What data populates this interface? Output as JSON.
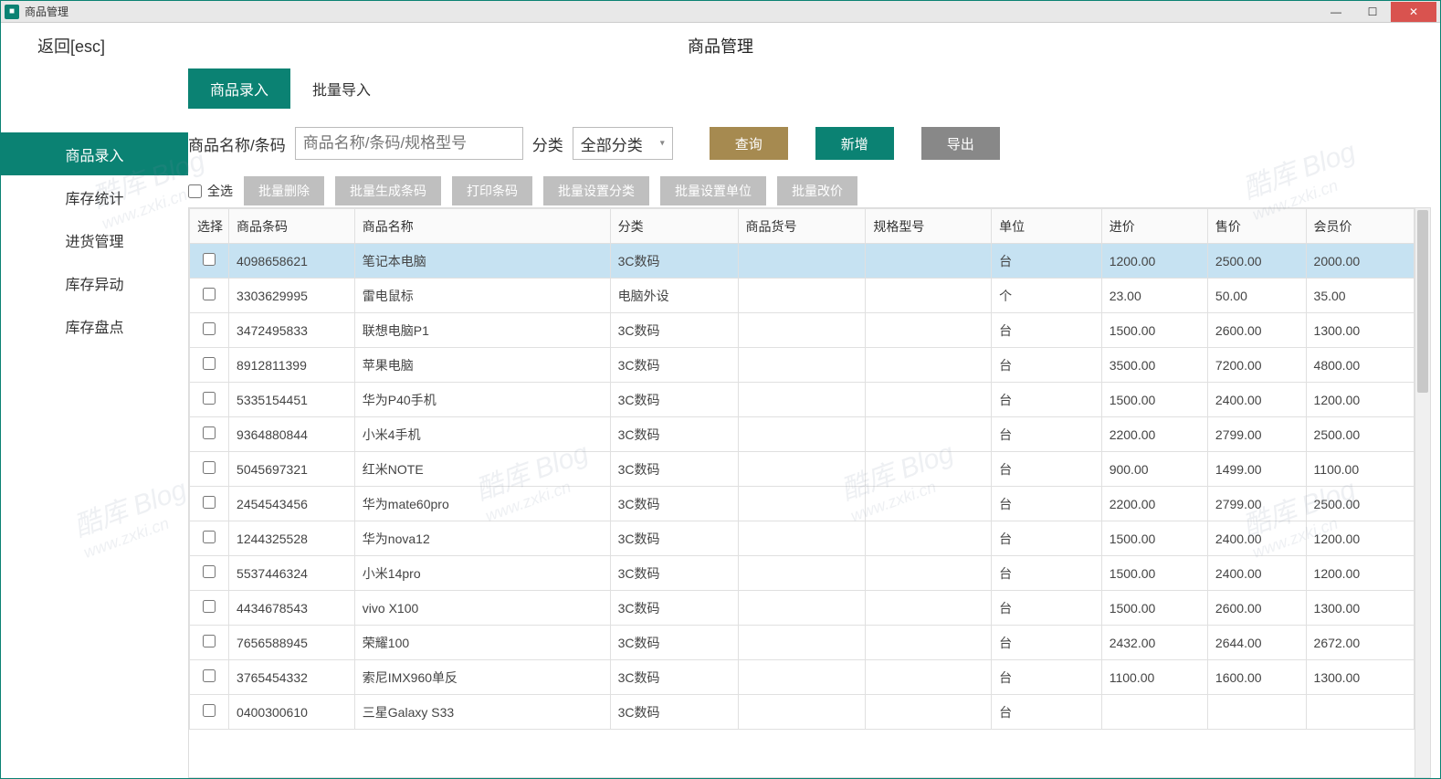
{
  "window": {
    "title": "商品管理"
  },
  "topbar": {
    "back": "返回[esc]",
    "title": "商品管理"
  },
  "sidebar": {
    "items": [
      {
        "label": "商品录入",
        "active": true
      },
      {
        "label": "库存统计",
        "active": false
      },
      {
        "label": "进货管理",
        "active": false
      },
      {
        "label": "库存异动",
        "active": false
      },
      {
        "label": "库存盘点",
        "active": false
      }
    ]
  },
  "tabs": [
    {
      "label": "商品录入",
      "active": true
    },
    {
      "label": "批量导入",
      "active": false
    }
  ],
  "filter": {
    "name_label": "商品名称/条码",
    "name_placeholder": "商品名称/条码/规格型号",
    "category_label": "分类",
    "category_value": "全部分类",
    "query_btn": "查询",
    "new_btn": "新增",
    "export_btn": "导出"
  },
  "batch": {
    "select_all": "全选",
    "buttons": [
      "批量删除",
      "批量生成条码",
      "打印条码",
      "批量设置分类",
      "批量设置单位",
      "批量改价"
    ]
  },
  "table": {
    "columns": [
      "选择",
      "商品条码",
      "商品名称",
      "分类",
      "商品货号",
      "规格型号",
      "单位",
      "进价",
      "售价",
      "会员价"
    ],
    "rows": [
      {
        "barcode": "4098658621",
        "name": "笔记本电脑",
        "category": "3C数码",
        "sku": "",
        "spec": "",
        "unit": "台",
        "cost": "1200.00",
        "price": "2500.00",
        "member": "2000.00",
        "highlight": true
      },
      {
        "barcode": "3303629995",
        "name": "雷电鼠标",
        "category": "电脑外设",
        "sku": "",
        "spec": "",
        "unit": "个",
        "cost": "23.00",
        "price": "50.00",
        "member": "35.00"
      },
      {
        "barcode": "3472495833",
        "name": "联想电脑P1",
        "category": "3C数码",
        "sku": "",
        "spec": "",
        "unit": "台",
        "cost": "1500.00",
        "price": "2600.00",
        "member": "1300.00"
      },
      {
        "barcode": "8912811399",
        "name": "苹果电脑",
        "category": "3C数码",
        "sku": "",
        "spec": "",
        "unit": "台",
        "cost": "3500.00",
        "price": "7200.00",
        "member": "4800.00"
      },
      {
        "barcode": "5335154451",
        "name": "华为P40手机",
        "category": "3C数码",
        "sku": "",
        "spec": "",
        "unit": "台",
        "cost": "1500.00",
        "price": "2400.00",
        "member": "1200.00"
      },
      {
        "barcode": "9364880844",
        "name": "小米4手机",
        "category": "3C数码",
        "sku": "",
        "spec": "",
        "unit": "台",
        "cost": "2200.00",
        "price": "2799.00",
        "member": "2500.00"
      },
      {
        "barcode": "5045697321",
        "name": "红米NOTE",
        "category": "3C数码",
        "sku": "",
        "spec": "",
        "unit": "台",
        "cost": "900.00",
        "price": "1499.00",
        "member": "1100.00"
      },
      {
        "barcode": "2454543456",
        "name": "华为mate60pro",
        "category": "3C数码",
        "sku": "",
        "spec": "",
        "unit": "台",
        "cost": "2200.00",
        "price": "2799.00",
        "member": "2500.00"
      },
      {
        "barcode": "1244325528",
        "name": "华为nova12",
        "category": "3C数码",
        "sku": "",
        "spec": "",
        "unit": "台",
        "cost": "1500.00",
        "price": "2400.00",
        "member": "1200.00"
      },
      {
        "barcode": "5537446324",
        "name": "小米14pro",
        "category": "3C数码",
        "sku": "",
        "spec": "",
        "unit": "台",
        "cost": "1500.00",
        "price": "2400.00",
        "member": "1200.00"
      },
      {
        "barcode": "4434678543",
        "name": "vivo X100",
        "category": "3C数码",
        "sku": "",
        "spec": "",
        "unit": "台",
        "cost": "1500.00",
        "price": "2600.00",
        "member": "1300.00"
      },
      {
        "barcode": "7656588945",
        "name": "荣耀100",
        "category": "3C数码",
        "sku": "",
        "spec": "",
        "unit": "台",
        "cost": "2432.00",
        "price": "2644.00",
        "member": "2672.00"
      },
      {
        "barcode": "3765454332",
        "name": "索尼IMX960单反",
        "category": "3C数码",
        "sku": "",
        "spec": "",
        "unit": "台",
        "cost": "1100.00",
        "price": "1600.00",
        "member": "1300.00"
      },
      {
        "barcode": "0400300610",
        "name": "三星Galaxy S33",
        "category": "3C数码",
        "sku": "",
        "spec": "",
        "unit": "台",
        "cost": "",
        "price": "",
        "member": ""
      }
    ]
  },
  "watermark": {
    "line1": "酷库 Blog",
    "line2": "www.zxki.cn"
  }
}
